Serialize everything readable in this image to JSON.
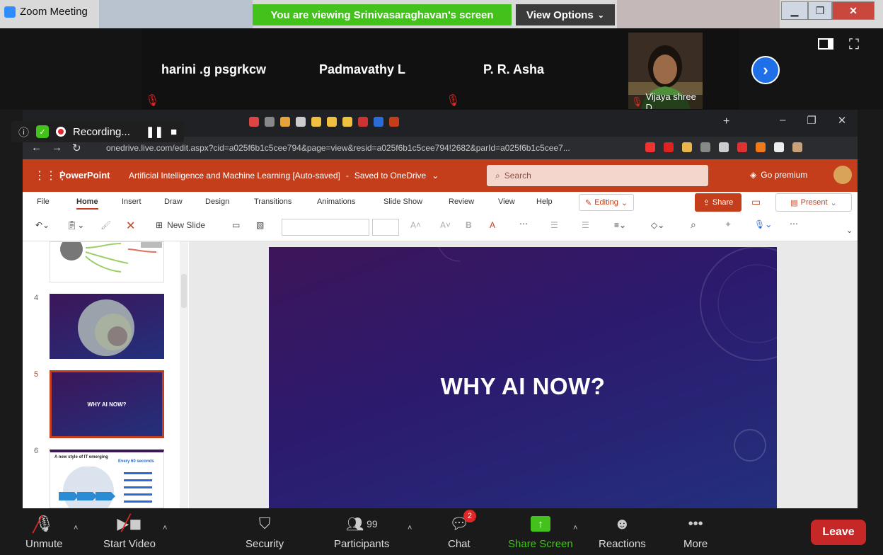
{
  "window": {
    "title": "Zoom Meeting"
  },
  "banner": {
    "viewing": "You are viewing Srinivasaraghavan's screen",
    "view_options": "View Options"
  },
  "participants": [
    {
      "name": "harini .g psgrkcw"
    },
    {
      "name": "Padmavathy L"
    },
    {
      "name": "P. R. Asha"
    },
    {
      "name": "Vijaya shree D"
    }
  ],
  "recording": {
    "label": "Recording..."
  },
  "browser": {
    "address": "onedrive.live.com/edit.aspx?cid=a025f6b1c5cee794&page=view&resid=a025f6b1c5cee794!2682&parId=a025f6b1c5cee7..."
  },
  "ppt": {
    "app": "PowerPoint",
    "doc_title": "Artificial Intelligence and Machine Learning [Auto-saved]",
    "saved": "Saved to OneDrive",
    "search_placeholder": "Search",
    "go_premium": "Go premium",
    "tabs": [
      "File",
      "Home",
      "Insert",
      "Draw",
      "Design",
      "Transitions",
      "Animations",
      "Slide Show",
      "Review",
      "View",
      "Help"
    ],
    "editing": "Editing",
    "share": "Share",
    "present": "Present",
    "new_slide": "New Slide",
    "slide_numbers": [
      "4",
      "5",
      "6"
    ],
    "current_slide_title": "WHY AI NOW?",
    "thumb5_title": "WHY AI NOW?",
    "thumb6_title": "A new style of IT emerging",
    "thumb6_subtitle": "Every 60 seconds"
  },
  "toolbar": {
    "unmute": "Unmute",
    "start_video": "Start Video",
    "security": "Security",
    "participants": "Participants",
    "participant_count": "99",
    "chat": "Chat",
    "chat_badge": "2",
    "share_screen": "Share Screen",
    "reactions": "Reactions",
    "more": "More",
    "leave": "Leave"
  },
  "colors": {
    "zoom_green": "#42c21a",
    "ppt_red": "#c43e1c",
    "leave_red": "#c62828",
    "zoom_blue": "#2d8cff"
  }
}
